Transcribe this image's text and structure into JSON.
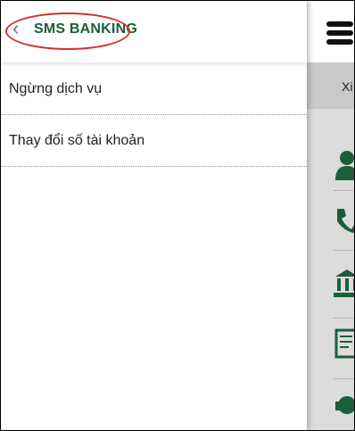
{
  "drawer": {
    "title": "SMS BANKING",
    "items": [
      {
        "label": "Ngừng dịch vụ"
      },
      {
        "label": "Thay đổi số tài khoản"
      }
    ]
  },
  "background_app": {
    "banner_text": "Xi"
  },
  "colors": {
    "accent": "#1b5e3b",
    "highlight": "#d32f2f"
  }
}
